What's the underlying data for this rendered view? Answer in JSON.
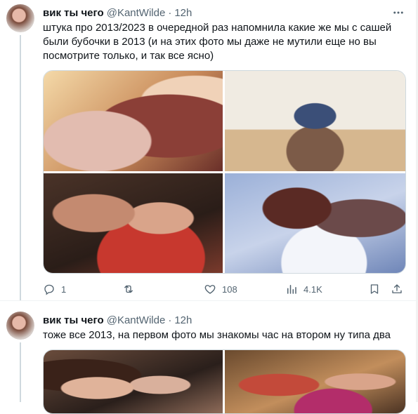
{
  "tweets": [
    {
      "author": {
        "name": "вик ты чего",
        "handle": "@KantWilde"
      },
      "separator": "·",
      "time": "12h",
      "text": "штука про 2013/2023 в очередной раз напомнила какие же мы с сашей были бубочки в 2013 (и на этих фото мы даже не мутили еще но вы посмотрите только, и так все ясно)",
      "media_count": 4,
      "actions": {
        "reply": {
          "icon": "reply-icon",
          "count": "1"
        },
        "retweet": {
          "icon": "retweet-icon",
          "count": ""
        },
        "like": {
          "icon": "heart-icon",
          "count": "108"
        },
        "views": {
          "icon": "analytics-icon",
          "count": "4.1K"
        },
        "bookmark": {
          "icon": "bookmark-icon"
        },
        "share": {
          "icon": "share-icon"
        }
      }
    },
    {
      "author": {
        "name": "вик ты чего",
        "handle": "@KantWilde"
      },
      "separator": "·",
      "time": "12h",
      "text": "тоже все 2013, на первом фото мы знакомы час на втором ну типа два",
      "media_count": 2
    }
  ],
  "colors": {
    "text": "#0f1419",
    "secondary": "#536471",
    "border": "#cfd9de",
    "divider": "#eff3f4"
  }
}
